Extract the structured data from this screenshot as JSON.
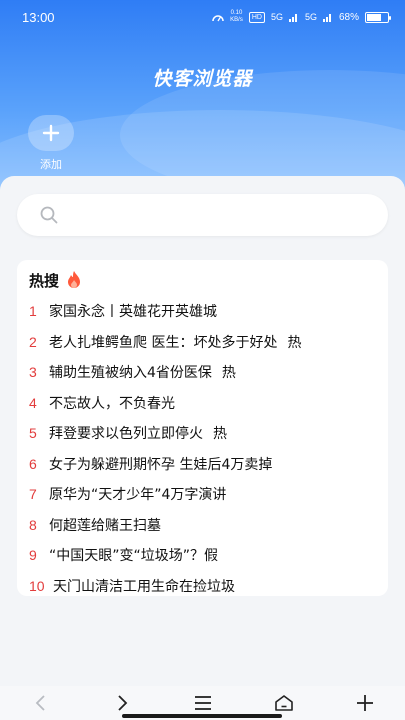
{
  "status_bar": {
    "time": "13:00",
    "speed_value": "0.10",
    "speed_unit": "KB/s",
    "hd_tag": "HD",
    "net1": "5G",
    "net2": "5G",
    "battery_percent": "68%",
    "battery_level": 0.68
  },
  "app": {
    "title": "快客浏览器"
  },
  "quick_add": {
    "label": "添加",
    "icon": "plus-icon"
  },
  "search": {
    "placeholder": "",
    "value": "",
    "icon": "search-icon"
  },
  "hot": {
    "title": "热搜",
    "icon": "fire-icon",
    "items": [
      {
        "rank": "1",
        "text": "家国永念丨英雄花开英雄城",
        "badge": ""
      },
      {
        "rank": "2",
        "text": "老人扎堆鳄鱼爬 医生：坏处多于好处",
        "badge": "热"
      },
      {
        "rank": "3",
        "text": "辅助生殖被纳入4省份医保",
        "badge": "热"
      },
      {
        "rank": "4",
        "text": "不忘故人，不负春光",
        "badge": ""
      },
      {
        "rank": "5",
        "text": "拜登要求以色列立即停火",
        "badge": "热"
      },
      {
        "rank": "6",
        "text": "女子为躲避刑期怀孕 生娃后4万卖掉",
        "badge": ""
      },
      {
        "rank": "7",
        "text": "原华为“天才少年”4万字演讲",
        "badge": ""
      },
      {
        "rank": "8",
        "text": "何超莲给赌王扫墓",
        "badge": ""
      },
      {
        "rank": "9",
        "text": "“中国天眼”变“垃圾场”？假",
        "badge": ""
      },
      {
        "rank": "10",
        "text": "天门山清洁工用生命在捡垃圾",
        "badge": ""
      }
    ]
  },
  "nav": {
    "items": [
      "back-icon",
      "forward-icon",
      "menu-icon",
      "home-icon",
      "new-tab-icon"
    ]
  },
  "colors": {
    "accent": "#2f7df5",
    "rank": "#e23c3c",
    "fire": "#ff5a3c"
  }
}
